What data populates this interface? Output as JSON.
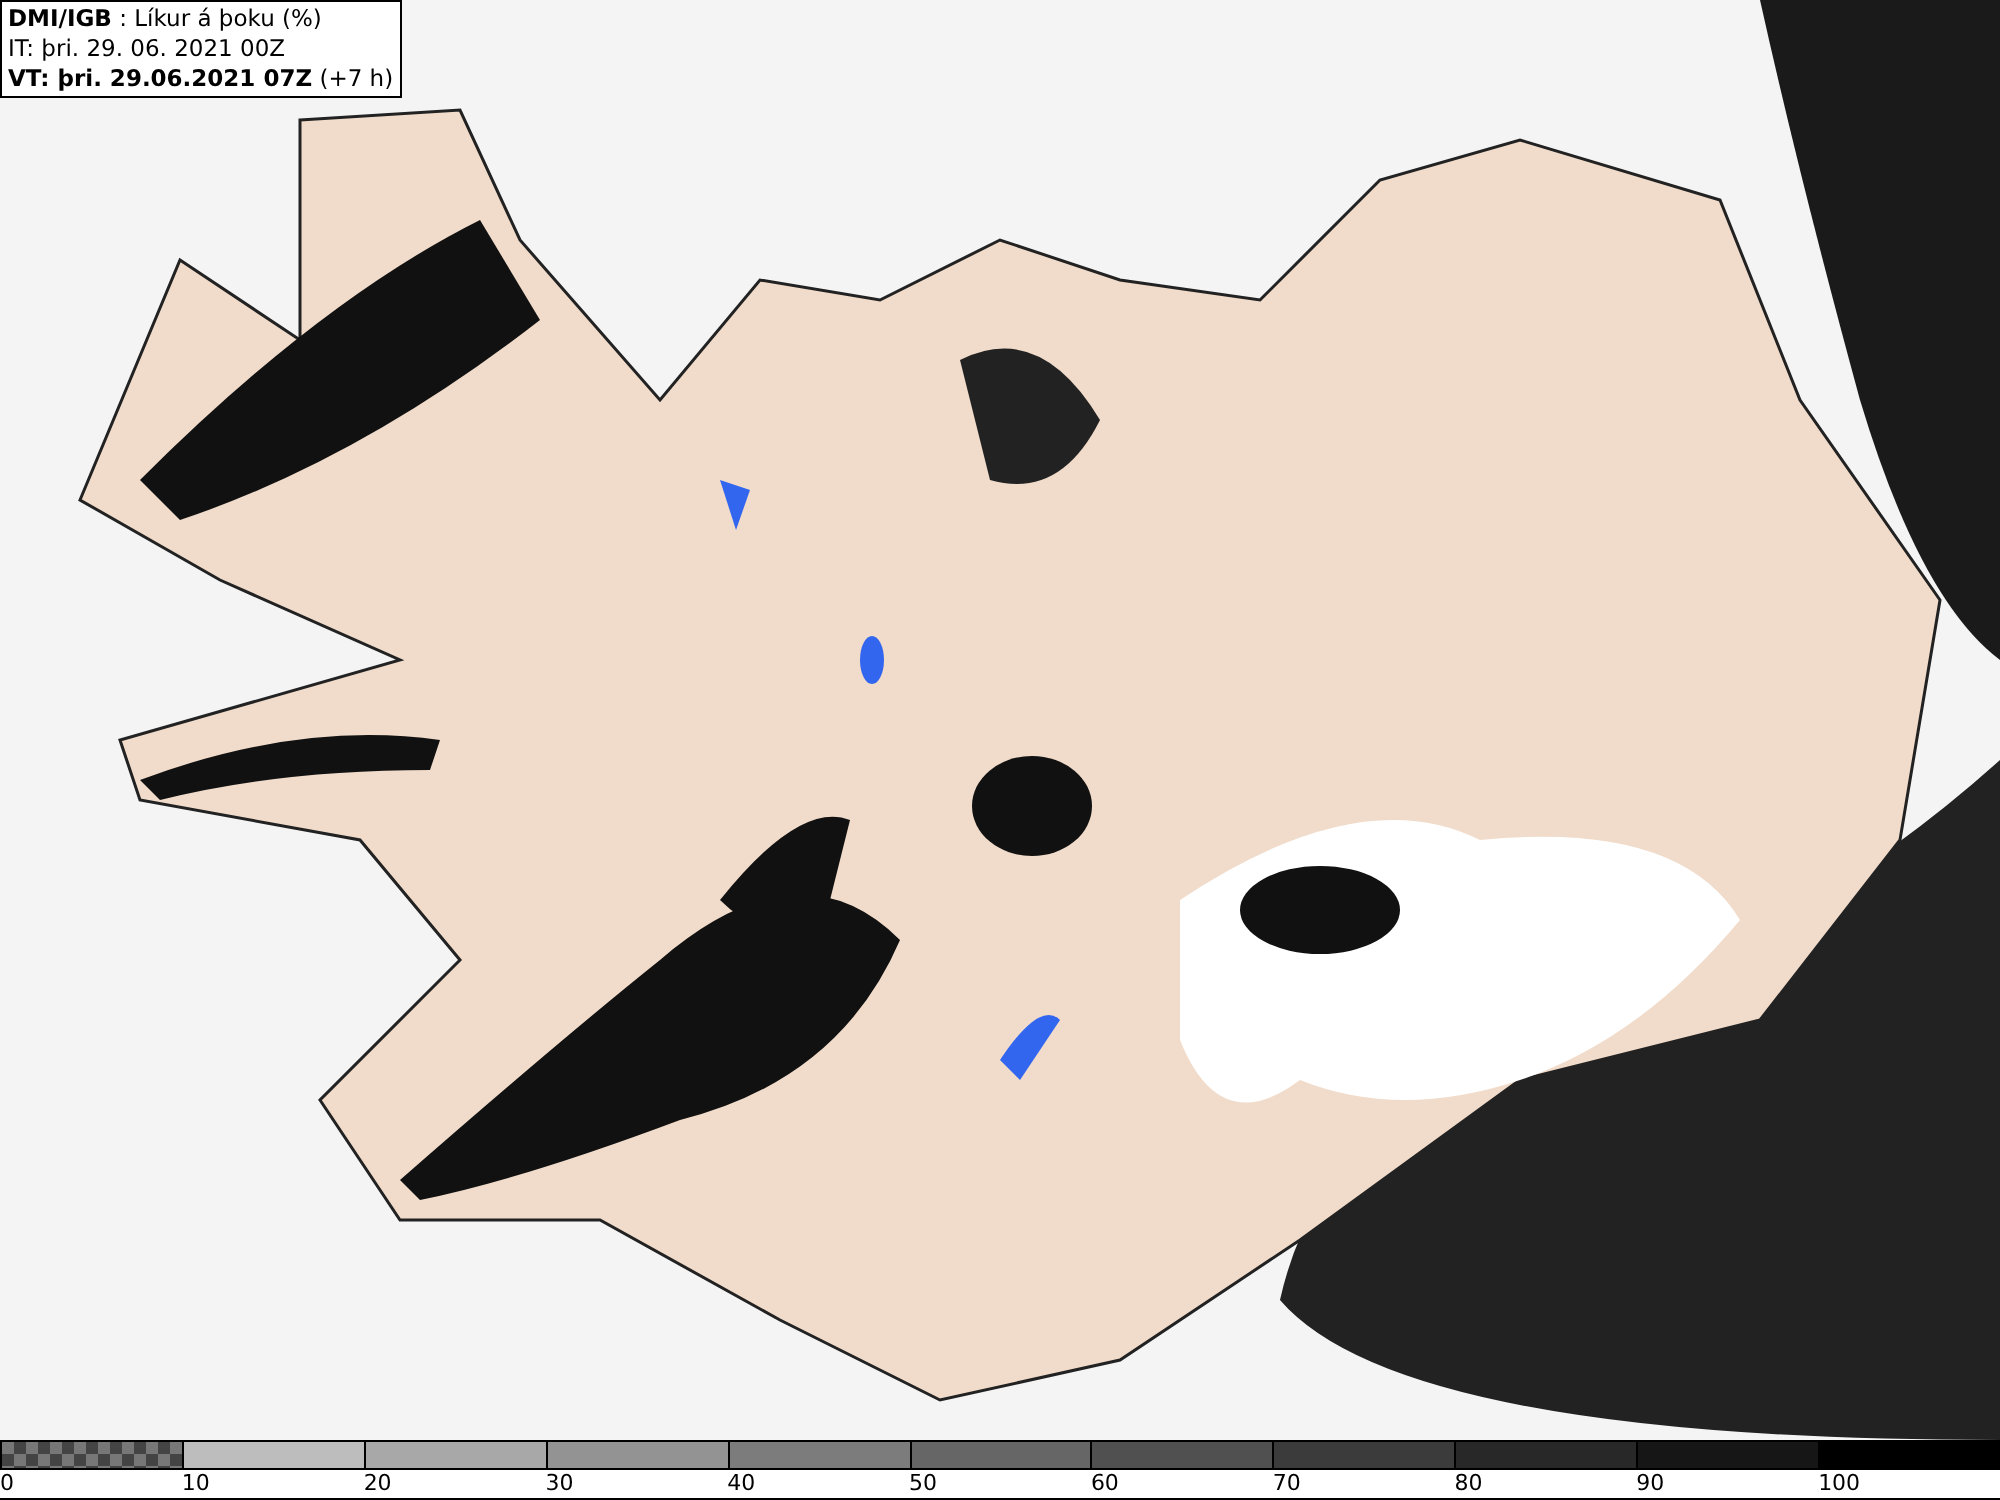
{
  "header": {
    "lines": [
      "**DMI/IGB** : Líkur á þoku (%)",
      "IT: þri. 29. 06. 2021 00Z",
      "**VT: þri. 29.06.2021 07Z** (+7 h)"
    ]
  },
  "legend": {
    "segments": [
      {
        "label": "0",
        "color": "#777777",
        "kind": "checker"
      },
      {
        "label": "10",
        "color": "#bdbdbd",
        "kind": "solid"
      },
      {
        "label": "20",
        "color": "#a8a8a8",
        "kind": "solid"
      },
      {
        "label": "30",
        "color": "#939393",
        "kind": "solid"
      },
      {
        "label": "40",
        "color": "#7c7c7c",
        "kind": "solid"
      },
      {
        "label": "50",
        "color": "#666666",
        "kind": "solid"
      },
      {
        "label": "60",
        "color": "#505050",
        "kind": "solid"
      },
      {
        "label": "70",
        "color": "#3b3b3b",
        "kind": "solid"
      },
      {
        "label": "80",
        "color": "#282828",
        "kind": "solid"
      },
      {
        "label": "90",
        "color": "#161616",
        "kind": "solid"
      },
      {
        "label": "100",
        "color": "#000000",
        "kind": "solid"
      }
    ]
  }
}
